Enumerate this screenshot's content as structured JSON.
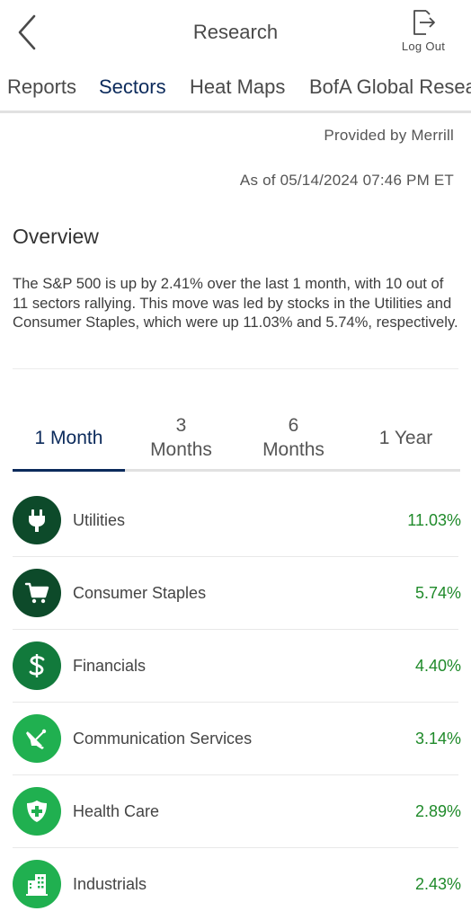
{
  "header": {
    "title": "Research",
    "logout_label": "Log Out"
  },
  "tabs": [
    {
      "label": "Reports"
    },
    {
      "label": "Sectors",
      "active": true
    },
    {
      "label": "Heat Maps"
    },
    {
      "label": "BofA Global Resea"
    }
  ],
  "provided_by": "Provided by Merrill",
  "as_of": "As of 05/14/2024 07:46 PM ET",
  "overview": {
    "title": "Overview",
    "text": "The S&P 500 is up by 2.41% over the last 1 month, with 10 out of 11 sectors rallying. This move was led by stocks in the Utilities and Consumer Staples, which were up 11.03% and 5.74%, respectively."
  },
  "periods": {
    "p0": "1 Month",
    "p1a": "3",
    "p1b": "Months",
    "p2a": "6",
    "p2b": "Months",
    "p3": "1 Year"
  },
  "sectors": [
    {
      "name": "Utilities",
      "value": "11.03%",
      "icon": "plug-icon",
      "color": "#0d4a2a"
    },
    {
      "name": "Consumer Staples",
      "value": "5.74%",
      "icon": "cart-icon",
      "color": "#0d4a2a"
    },
    {
      "name": "Financials",
      "value": "4.40%",
      "icon": "dollar-icon",
      "color": "#127a3c"
    },
    {
      "name": "Communication Services",
      "value": "3.14%",
      "icon": "satellite-icon",
      "color": "#20b050"
    },
    {
      "name": "Health Care",
      "value": "2.89%",
      "icon": "shield-plus-icon",
      "color": "#20b050"
    },
    {
      "name": "Industrials",
      "value": "2.43%",
      "icon": "building-icon",
      "color": "#20b050"
    }
  ],
  "colors": {
    "accent": "#0b2a5b",
    "positive": "#1f8a2a"
  }
}
